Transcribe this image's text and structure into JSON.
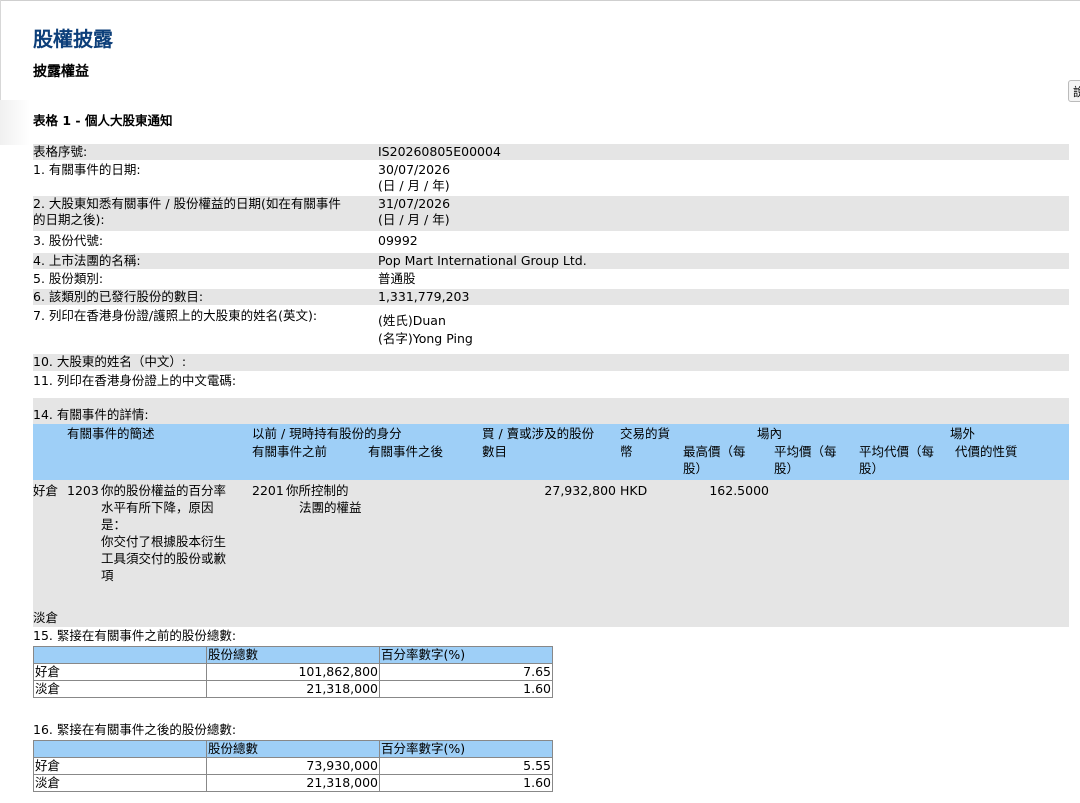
{
  "header": {
    "title": "股權披露",
    "subtitle": "披露權益",
    "form_title": "表格 1 - 個人大股東通知",
    "corner_char": "說"
  },
  "fields": [
    {
      "label": "表格序號:",
      "value": "IS20260805E00004"
    },
    {
      "label": "1. 有關事件的日期:",
      "value": "30/07/2026",
      "note": "(日 / 月 / 年)"
    },
    {
      "label": "2. 大股東知悉有關事件 / 股份權益的日期(如在有關事件",
      "label2": "的日期之後):",
      "value": "31/07/2026",
      "note": "(日 / 月 / 年)"
    },
    {
      "label": "3. 股份代號:",
      "value": "09992"
    },
    {
      "label": "4. 上市法團的名稱:",
      "value": "Pop Mart International Group Ltd."
    },
    {
      "label": "5. 股份類別:",
      "value": "普通股"
    },
    {
      "label": "6. 該類別的已發行股份的數目:",
      "value": "1,331,779,203"
    },
    {
      "label": "7. 列印在香港身份證/護照上的大股東的姓名(英文):",
      "value": "(姓氏)Duan",
      "value2": "(名字)Yong Ping"
    },
    {
      "label": "10. 大股東的姓名（中文）:"
    },
    {
      "label": "11. 列印在香港身份證上的中文電碼:"
    },
    {
      "label": "14. 有關事件的詳情:"
    }
  ],
  "event_table": {
    "headers": {
      "desc": "有關事件的簡述",
      "capacity": "以前 / 現時持有股份的身分",
      "before": "有關事件之前",
      "after": "有關事件之後",
      "shares_1": "買 / 賣或涉及的股份",
      "shares_2": "數目",
      "currency_1": "交易的貨",
      "currency_2": "幣",
      "onex": "場內",
      "offex": "場外",
      "highest_1": "最高價（每",
      "highest_2": "股）",
      "average_1": "平均價（每",
      "average_2": "股）",
      "avg_consideration_1": "平均代價（每",
      "avg_consideration_2": "股）",
      "nature": "代價的性質"
    },
    "row": {
      "position": "好倉",
      "code": "1203",
      "desc_lines": [
        "你的股份權益的百分率",
        "水平有所下降，原因",
        "是：",
        "你交付了根據股本衍生",
        "工具須交付的股份或歉",
        "項"
      ],
      "cap_code": "2201",
      "cap_lines": [
        "你所控制的",
        "法團的權益"
      ],
      "shares": "27,932,800",
      "currency": "HKD",
      "highest": "162.5000"
    },
    "short_label": "淡倉"
  },
  "totals_before": {
    "title": "15. 緊接在有關事件之前的股份總數:",
    "col_shares": "股份總數",
    "col_pct": "百分率數字(%)",
    "rows": [
      {
        "label": "好倉",
        "shares": "101,862,800",
        "pct": "7.65"
      },
      {
        "label": "淡倉",
        "shares": "21,318,000",
        "pct": "1.60"
      }
    ]
  },
  "totals_after": {
    "title": "16. 緊接在有關事件之後的股份總數:",
    "col_shares": "股份總數",
    "col_pct": "百分率數字(%)",
    "rows": [
      {
        "label": "好倉",
        "shares": "73,930,000",
        "pct": "5.55"
      },
      {
        "label": "淡倉",
        "shares": "21,318,000",
        "pct": "1.60"
      }
    ]
  }
}
